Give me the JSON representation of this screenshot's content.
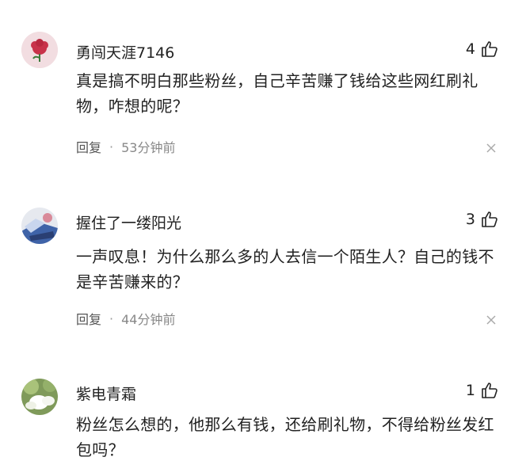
{
  "comments": [
    {
      "username": "勇闯天涯7146",
      "likes": "4",
      "text": "真是搞不明白那些粉丝，自己辛苦赚了钱给这些网红刷礼物，咋想的呢？",
      "reply_label": "回复",
      "dot": "·",
      "time": "53分钟前",
      "avatar": "flower-icon"
    },
    {
      "username": "握住了一缕阳光",
      "likes": "3",
      "text": "一声叹息！为什么那么多的人去信一个陌生人？自己的钱不是辛苦赚来的？",
      "reply_label": "回复",
      "dot": "·",
      "time": "44分钟前",
      "avatar": "photo-avatar"
    },
    {
      "username": "紫电青霜",
      "likes": "1",
      "text": "粉丝怎么想的，他那么有钱，还给刷礼物，不得给粉丝发红包吗？",
      "avatar": "photo-avatar"
    }
  ],
  "colors": {
    "text": "#222222",
    "meta": "#888888",
    "avatar1_bg": "#f3d9dd",
    "flower": "#c8324a"
  }
}
